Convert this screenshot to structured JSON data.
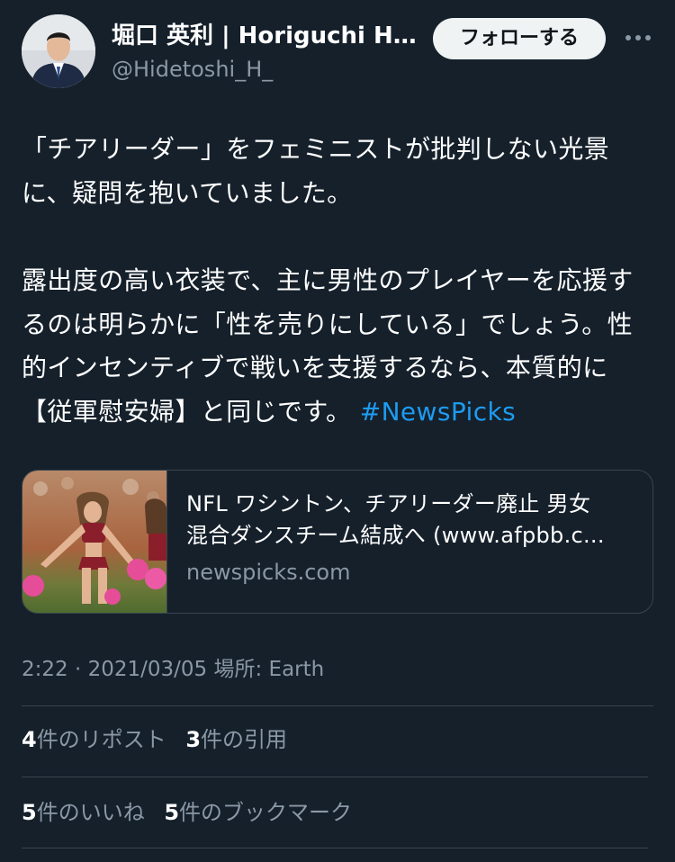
{
  "user": {
    "display_name": "堀口 英利 | Horiguchi Hi...",
    "handle": "@Hidetoshi_H_",
    "avatar_icon": "profile-photo"
  },
  "actions": {
    "follow_label": "フォローする",
    "more_icon": "more-horizontal-icon"
  },
  "tweet": {
    "paragraph1": "「チアリーダー」をフェミニストが批判しない光景に、疑問を抱いていました。",
    "paragraph2": "露出度の高い衣装で、主に男性のプレイヤーを応援するのは明らかに「性を売りにしている」でしょう。性的インセンティブで戦いを支援するなら、本質的に【従軍慰安婦】と同じです。",
    "hashtag": "#NewsPicks"
  },
  "card": {
    "title_line1": "NFL ワシントン、チアリーダー廃止 男女",
    "title_line2": "混合ダンスチーム結成へ (www.afpbb.c...",
    "domain": "newspicks.com"
  },
  "meta": {
    "time": "2:22",
    "separator": "·",
    "date": "2021/03/05",
    "location": "場所: Earth"
  },
  "stats": {
    "reposts_count": "4",
    "reposts_label": "件のリポスト",
    "quotes_count": "3",
    "quotes_label": "件の引用",
    "likes_count": "5",
    "likes_label": "件のいいね",
    "bookmarks_count": "5",
    "bookmarks_label": "件のブックマーク"
  },
  "colors": {
    "background": "#15202b",
    "accent": "#1d9bf0",
    "secondary_text": "#8b98a5",
    "border": "#38444d"
  }
}
